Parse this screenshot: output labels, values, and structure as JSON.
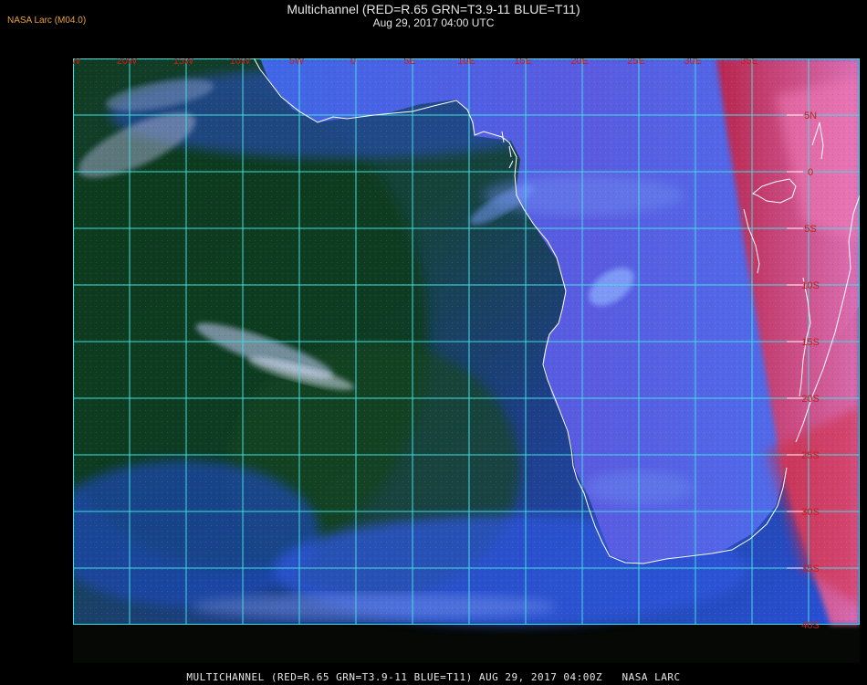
{
  "header": {
    "credit": "NASA Larc (M04.0)",
    "title": "Multichannel (RED=R.65 GRN=T3.9-11 BLUE=T11)",
    "subtitle": "Aug 29, 2017 04:00 UTC"
  },
  "footer": {
    "caption": "MULTICHANNEL (RED=R.65 GRN=T3.9-11 BLUE=T11) AUG 29, 2017 04:00Z   NASA LARC"
  },
  "map": {
    "longitude_labels": [
      "25W",
      "20W",
      "15W",
      "10W",
      "5W",
      "0",
      "5E",
      "10E",
      "15E",
      "20E",
      "25E",
      "30E",
      "35E"
    ],
    "latitude_labels": [
      "5N",
      "0",
      "5S",
      "10S",
      "15S",
      "20S",
      "25S",
      "30S",
      "35S",
      "40S"
    ],
    "colors": {
      "grid": "#3fe0e0",
      "coastline": "#ffffff",
      "label": "#c81e1e",
      "ocean_blue": "#2a4fd0",
      "ocean_green": "#10361e",
      "land_hot": "#e0325a"
    }
  }
}
